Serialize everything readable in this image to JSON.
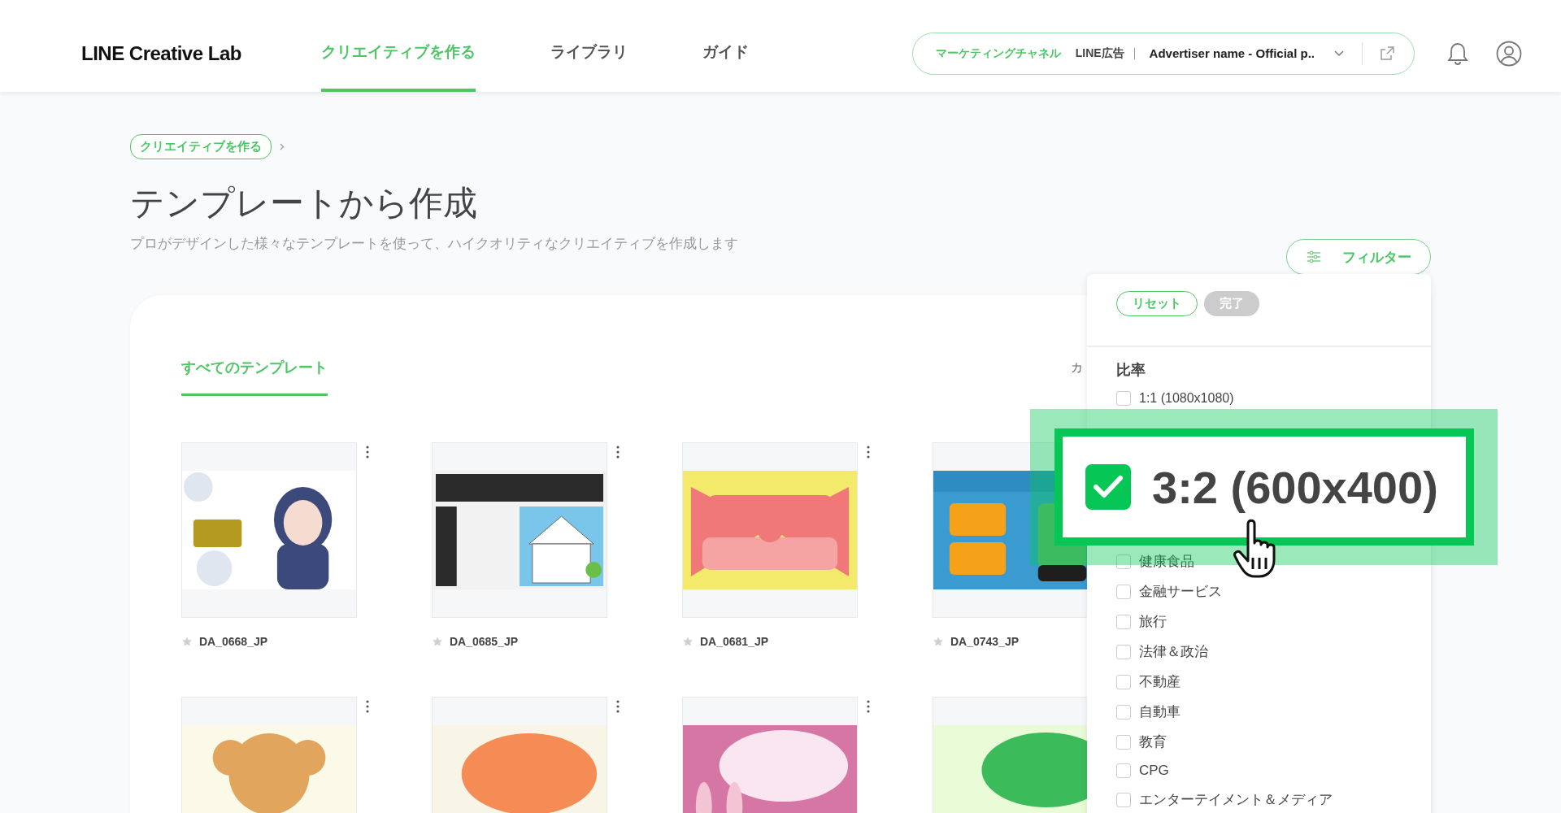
{
  "header": {
    "logo": "LINE Creative Lab",
    "nav": [
      {
        "label": "クリエイティブを作る",
        "selected": true
      },
      {
        "label": "ライブラリ",
        "selected": false
      },
      {
        "label": "ガイド",
        "selected": false
      }
    ],
    "account": {
      "channel_label": "マーケティングチャネル",
      "channel": "LINE広告",
      "advertiser": "Advertiser name - Official p.."
    }
  },
  "breadcrumb": [
    "クリエイティブを作る"
  ],
  "page": {
    "title": "テンプレートから作成",
    "subtitle": "プロがデザインした様々なテンプレートを使って、ハイクオリティなクリエイティブを作成します"
  },
  "filter_button": "フィルター",
  "tabs": [
    {
      "label": "すべてのテンプレート",
      "selected": true
    }
  ],
  "cut_label": "カ",
  "templates": [
    {
      "kind": "picture",
      "name": "DA_0668_JP",
      "favorite": false
    },
    {
      "kind": "picture",
      "name": "DA_0685_JP",
      "favorite": false
    },
    {
      "kind": "picture",
      "name": "DA_0681_JP",
      "favorite": false
    },
    {
      "kind": "picture",
      "name": "DA_0743_JP",
      "favorite": false
    },
    {
      "kind": "picture"
    },
    {
      "kind": "picture"
    },
    {
      "kind": "picture"
    },
    {
      "kind": "picture"
    }
  ],
  "filter_panel": {
    "reset": "リセット",
    "done": "完了",
    "done_disabled": true,
    "section_title": "比率",
    "options": [
      {
        "label": "1:1 (1080x1080)",
        "checked": false
      }
    ],
    "categories": [
      {
        "label": "健康食品",
        "checked": false
      },
      {
        "label": "金融サービス",
        "checked": false
      },
      {
        "label": "旅行",
        "checked": false
      },
      {
        "label": "法律＆政治",
        "checked": false
      },
      {
        "label": "不動産",
        "checked": false
      },
      {
        "label": "自動車",
        "checked": false
      },
      {
        "label": "教育",
        "checked": false
      },
      {
        "label": "CPG",
        "checked": false
      },
      {
        "label": "エンターテイメント＆メディア",
        "checked": false
      }
    ]
  },
  "callout": {
    "label": "3:2 (600x400)",
    "checked": true
  }
}
